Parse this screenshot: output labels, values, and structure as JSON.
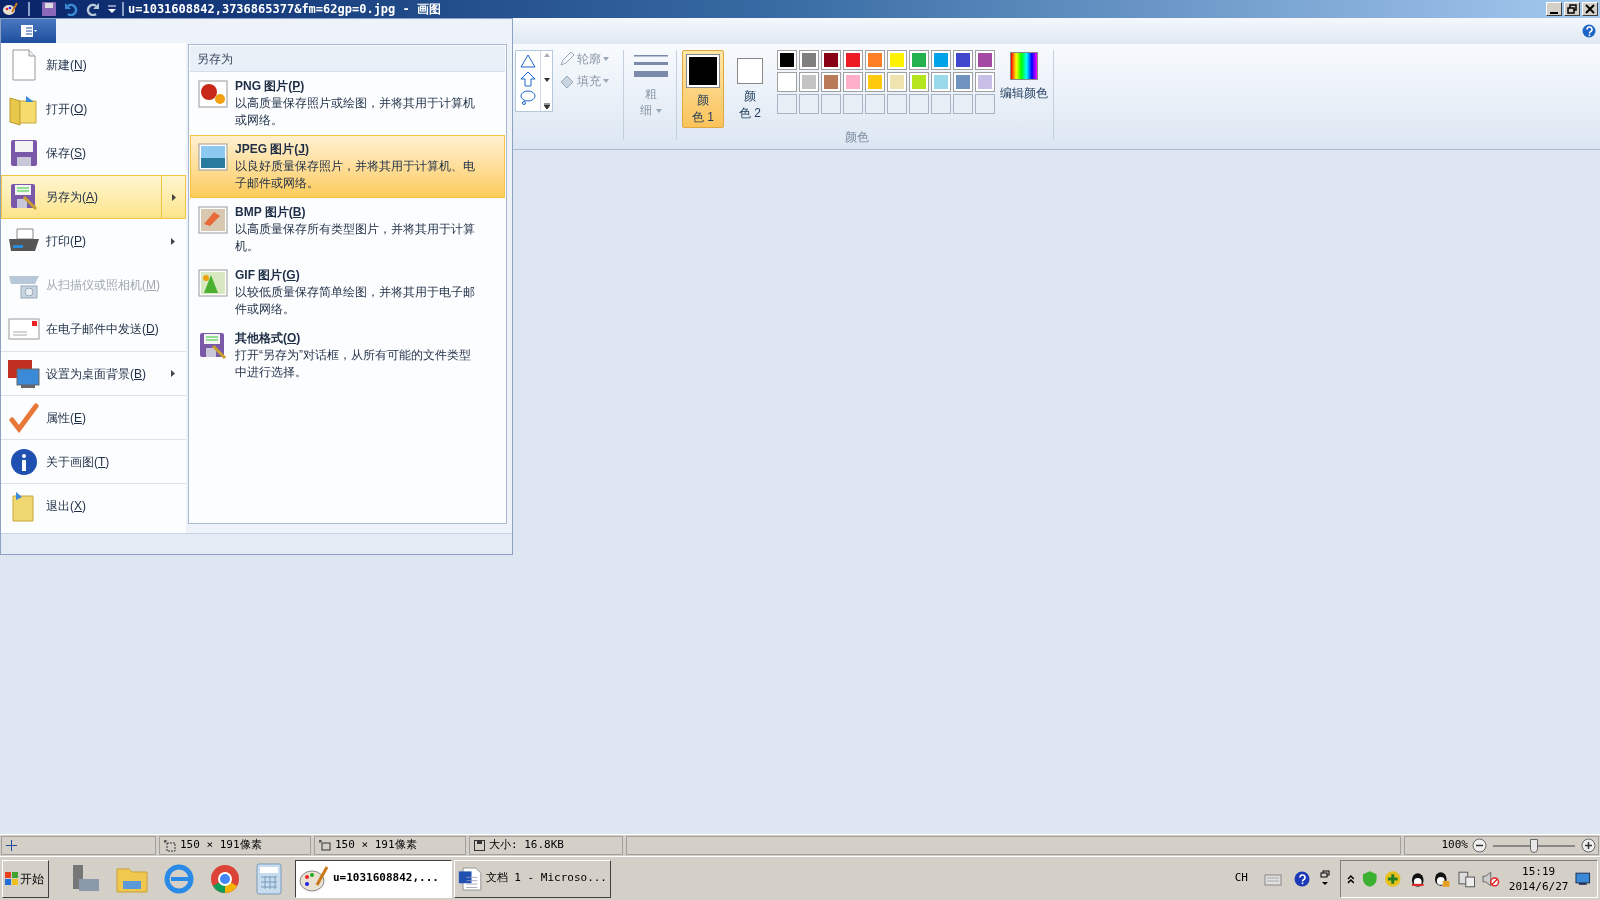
{
  "window": {
    "title": "u=1031608842,3736865377&fm=62gp=0.jpg - 画图"
  },
  "file_menu": {
    "items": [
      {
        "label": "新建(N)",
        "disabled": false,
        "submenu": false,
        "selected": false
      },
      {
        "label": "打开(O)",
        "disabled": false,
        "submenu": false,
        "selected": false
      },
      {
        "label": "保存(S)",
        "disabled": false,
        "submenu": false,
        "selected": false
      },
      {
        "label": "另存为(A)",
        "disabled": false,
        "submenu": true,
        "selected": true
      },
      {
        "label": "打印(P)",
        "disabled": false,
        "submenu": true,
        "selected": false
      },
      {
        "label": "从扫描仪或照相机(M)",
        "disabled": true,
        "submenu": false,
        "selected": false
      },
      {
        "label": "在电子邮件中发送(D)",
        "disabled": false,
        "submenu": false,
        "selected": false
      },
      {
        "label": "设置为桌面背景(B)",
        "disabled": false,
        "submenu": true,
        "selected": false
      },
      {
        "label": "属性(E)",
        "disabled": false,
        "submenu": false,
        "selected": false
      },
      {
        "label": "关于画图(T)",
        "disabled": false,
        "submenu": false,
        "selected": false
      },
      {
        "label": "退出(X)",
        "disabled": false,
        "submenu": false,
        "selected": false
      }
    ],
    "submenu": {
      "title": "另存为",
      "items": [
        {
          "title": "PNG 图片(P)",
          "description": "以高质量保存照片或绘图，并将其用于计算机或网络。",
          "selected": false
        },
        {
          "title": "JPEG 图片(J)",
          "description": "以良好质量保存照片，并将其用于计算机、电子邮件或网络。",
          "selected": true
        },
        {
          "title": "BMP 图片(B)",
          "description": "以高质量保存所有类型图片，并将其用于计算机。",
          "selected": false
        },
        {
          "title": "GIF 图片(G)",
          "description": "以较低质量保存简单绘图，并将其用于电子邮件或网络。",
          "selected": false
        },
        {
          "title": "其他格式(O)",
          "description": "打开“另存为”对话框，从所有可能的文件类型中进行选择。",
          "selected": false
        }
      ]
    }
  },
  "ribbon": {
    "outline": "轮廓",
    "fill": "填充",
    "size_lines": [
      "粗",
      "细"
    ],
    "color1": {
      "lines": [
        "颜",
        "色 1"
      ],
      "selected": true
    },
    "color2": {
      "lines": [
        "颜",
        "色 2"
      ],
      "selected": false
    },
    "palette": [
      {
        "color": "#000000"
      },
      {
        "color": "#7f7f7f"
      },
      {
        "color": "#880015"
      },
      {
        "color": "#ed1c24"
      },
      {
        "color": "#ff7f27"
      },
      {
        "color": "#fff200"
      },
      {
        "color": "#22b14c"
      },
      {
        "color": "#00a2e8"
      },
      {
        "color": "#3f48cc"
      },
      {
        "color": "#a349a4"
      },
      {
        "color": "#ffffff"
      },
      {
        "color": "#c3c3c3"
      },
      {
        "color": "#b97a57"
      },
      {
        "color": "#ffaec9"
      },
      {
        "color": "#ffc90e"
      },
      {
        "color": "#efe4b0"
      },
      {
        "color": "#b5e61d"
      },
      {
        "color": "#99d9ea"
      },
      {
        "color": "#7092be"
      },
      {
        "color": "#c8bfe7"
      }
    ],
    "edit_colors": "编辑颜色",
    "group_label": "颜色"
  },
  "status_bar": {
    "selection_size": "150 × 191像素",
    "image_size": "150 × 191像素",
    "file_size": "大小: 16.8KB",
    "zoom": "100%",
    "zoom_slider": {
      "level": 0.5
    }
  },
  "taskbar": {
    "start": "开始",
    "tasks": [
      {
        "label": "u=1031608842,...",
        "selected": true
      },
      {
        "label": "文档 1 - Microso...",
        "selected": false
      }
    ],
    "language": "CH",
    "time": "15:19",
    "date": "2014/6/27"
  }
}
